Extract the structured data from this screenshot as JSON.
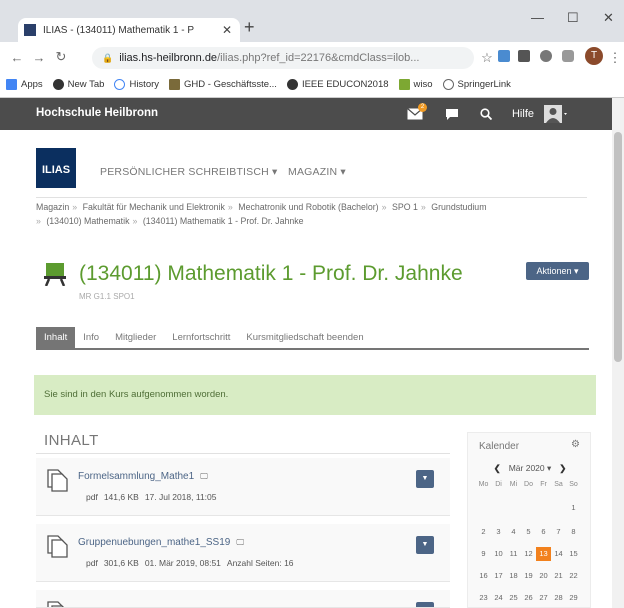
{
  "browser": {
    "tab_title": "ILIAS - (134011) Mathematik 1 - P",
    "url_domain": "ilias.hs-heilbronn.de",
    "url_path": "/ilias.php?ref_id=22176&cmdClass=ilob...",
    "new_tab_label": "+",
    "bookmarks": [
      "Apps",
      "New Tab",
      "History",
      "GHD - Geschäftsste...",
      "IEEE EDUCON2018",
      "wiso",
      "SpringerLink"
    ]
  },
  "header": {
    "brand": "Hochschule Heilbronn",
    "mail_badge": "2",
    "help": "Hilfe"
  },
  "logo": "ILIAS",
  "nav": {
    "desk": "PERSÖNLICHER SCHREIBTISCH ▾",
    "magazin": "MAGAZIN ▾"
  },
  "breadcrumb": [
    "Magazin",
    "Fakultät für Mechanik und Elektronik",
    "Mechatronik und Robotik (Bachelor)",
    "SPO 1",
    "Grundstudium",
    "(134010) Mathematik",
    "(134011) Mathematik 1 - Prof. Dr. Jahnke"
  ],
  "course": {
    "title": "(134011) Mathematik 1 - Prof. Dr. Jahnke",
    "subtitle": "MR G1.1 SPO1",
    "actions": "Aktionen ▾"
  },
  "tabs": [
    "Inhalt",
    "Info",
    "Mitglieder",
    "Lernfortschritt",
    "Kursmitgliedschaft beenden"
  ],
  "message": "Sie sind in den Kurs aufgenommen worden.",
  "content": {
    "heading": "INHALT",
    "items": [
      {
        "name": "Formelsammlung_Mathe1",
        "type": "pdf",
        "size": "141,6 KB",
        "date": "17. Jul 2018, 11:05",
        "extra": ""
      },
      {
        "name": "Gruppenuebungen_mathe1_SS19",
        "type": "pdf",
        "size": "301,6 KB",
        "date": "01. Mär 2019, 08:51",
        "extra": "Anzahl Seiten: 16"
      },
      {
        "name": "",
        "type": "",
        "size": "",
        "date": "",
        "extra": ""
      }
    ]
  },
  "calendar": {
    "title": "Kalender",
    "month": "Mär 2020 ▾",
    "weekdays": [
      "Mo",
      "Di",
      "Mi",
      "Do",
      "Fr",
      "Sa",
      "So"
    ],
    "weeks": [
      [
        "",
        "",
        "",
        "",
        "",
        "",
        "1"
      ],
      [
        "2",
        "3",
        "4",
        "5",
        "6",
        "7",
        "8"
      ],
      [
        "9",
        "10",
        "11",
        "12",
        "13",
        "14",
        "15"
      ],
      [
        "16",
        "17",
        "18",
        "19",
        "20",
        "21",
        "22"
      ],
      [
        "23",
        "24",
        "25",
        "26",
        "27",
        "28",
        "29"
      ]
    ],
    "today": "13"
  },
  "colors": {
    "header_bg": "#4c4c4c",
    "title_green": "#5c9b2f",
    "button_blue": "#4c6586",
    "success_bg": "#d8ecc4",
    "today_orange": "#f2811d",
    "logo_navy": "#0b2f5f"
  }
}
